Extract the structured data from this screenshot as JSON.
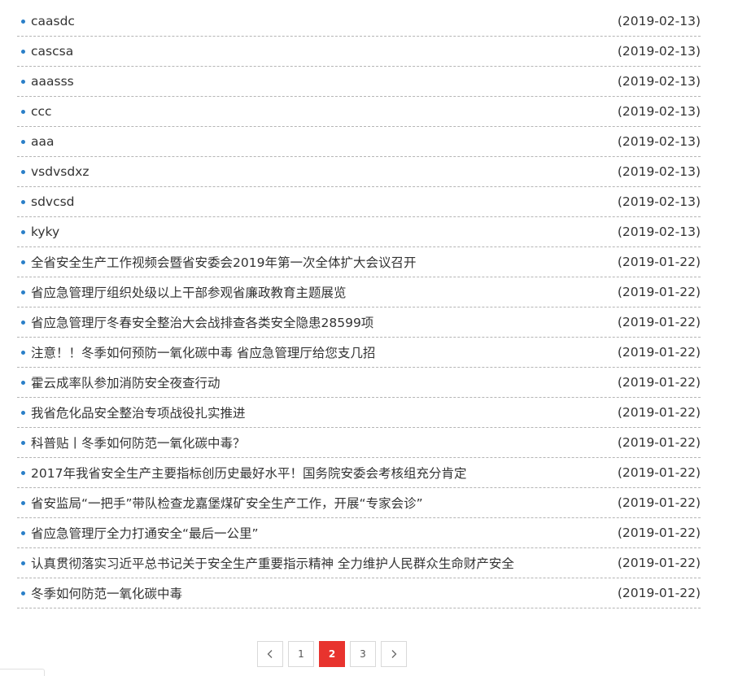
{
  "news": [
    {
      "title": "caasdc",
      "date": "(2019-02-13)"
    },
    {
      "title": "cascsa",
      "date": "(2019-02-13)"
    },
    {
      "title": "aaasss",
      "date": "(2019-02-13)"
    },
    {
      "title": "ccc",
      "date": "(2019-02-13)"
    },
    {
      "title": "aaa",
      "date": "(2019-02-13)"
    },
    {
      "title": "vsdvsdxz",
      "date": "(2019-02-13)"
    },
    {
      "title": "sdvcsd",
      "date": "(2019-02-13)"
    },
    {
      "title": "kyky",
      "date": "(2019-02-13)"
    },
    {
      "title": "全省安全生产工作视频会暨省安委会2019年第一次全体扩大会议召开",
      "date": "(2019-01-22)"
    },
    {
      "title": "省应急管理厅组织处级以上干部参观省廉政教育主题展览",
      "date": "(2019-01-22)"
    },
    {
      "title": "省应急管理厅冬春安全整治大会战排查各类安全隐患28599项",
      "date": "(2019-01-22)"
    },
    {
      "title": "注意！！冬季如何预防一氧化碳中毒 省应急管理厅给您支几招",
      "date": "(2019-01-22)"
    },
    {
      "title": "霍云成率队参加消防安全夜查行动",
      "date": "(2019-01-22)"
    },
    {
      "title": "我省危化品安全整治专项战役扎实推进",
      "date": "(2019-01-22)"
    },
    {
      "title": "科普贴丨冬季如何防范一氧化碳中毒？",
      "date": "(2019-01-22)"
    },
    {
      "title": "2017年我省安全生产主要指标创历史最好水平！国务院安委会考核组充分肯定",
      "date": "(2019-01-22)"
    },
    {
      "title": "省安监局“一把手”带队检查龙嘉堡煤矿安全生产工作，开展“专家会诊”",
      "date": "(2019-01-22)"
    },
    {
      "title": "省应急管理厅全力打通安全“最后一公里”",
      "date": "(2019-01-22)"
    },
    {
      "title": "认真贯彻落实习近平总书记关于安全生产重要指示精神 全力维护人民群众生命财产安全",
      "date": "(2019-01-22)"
    },
    {
      "title": "冬季如何防范一氧化碳中毒",
      "date": "(2019-01-22)"
    }
  ],
  "pagination": {
    "prev_icon": "chevron-left-icon",
    "next_icon": "chevron-right-icon",
    "pages": [
      "1",
      "2",
      "3"
    ],
    "current": "2",
    "active_color": "#e8332e"
  },
  "colors": {
    "bullet": "#2a7fc8",
    "divider": "#b5b5b5",
    "text": "#333333"
  }
}
